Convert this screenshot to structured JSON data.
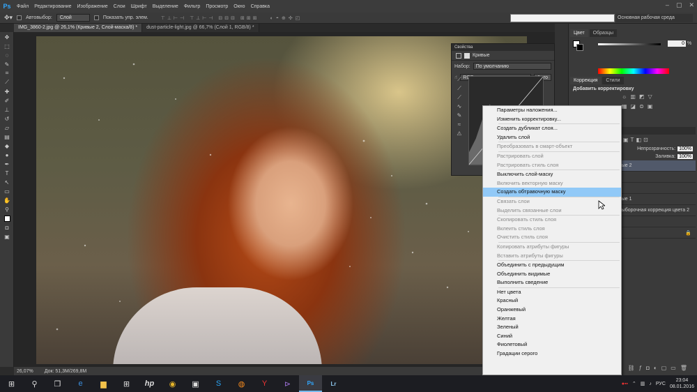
{
  "menu": {
    "logo": "Ps",
    "items": [
      "Файл",
      "Редактирование",
      "Изображение",
      "Слои",
      "Шрифт",
      "Выделение",
      "Фильтр",
      "Просмотр",
      "Окно",
      "Справка"
    ]
  },
  "options": {
    "autoselect": "Автовыбор:",
    "layer_select": "Слой",
    "show_controls": "Показать упр. элем.",
    "workspace": "Основная рабочая среда"
  },
  "tabs": [
    "IMG_3860-2.jpg @ 26,1% (Кривые 2, Слой-маска/8) *",
    "dust-particle-light.jpg @ 66,7% (Слой 1, RGB/8) *"
  ],
  "status": {
    "zoom": "26,07%",
    "doc": "Док: 51,3M/269,8M"
  },
  "properties": {
    "tab": "Свойства",
    "title": "Кривые",
    "preset_label": "Набор:",
    "preset_value": "По умолчанию",
    "channel": "RGB",
    "auto": "Авто"
  },
  "right_panel": {
    "color_tabs": [
      "Цвет",
      "Образцы"
    ],
    "color_value": "0",
    "color_unit": "%",
    "adj_tabs": [
      "Коррекция",
      "Стили"
    ],
    "adj_title": "Добавить корректировку",
    "opacity_label": "Непрозрачность:",
    "opacity_value": "100%",
    "fill_label": "Заливка:",
    "fill_value": "100%",
    "layers": [
      "вые 2",
      "вые 1",
      "выборочная коррекция цвета 2"
    ]
  },
  "context_menu": [
    {
      "label": "Параметры наложения...",
      "disabled": false
    },
    {
      "label": "Изменить корректировку...",
      "disabled": false
    },
    {
      "sep": true
    },
    {
      "label": "Создать дубликат слоя...",
      "disabled": false
    },
    {
      "label": "Удалить слой",
      "disabled": false
    },
    {
      "sep": true
    },
    {
      "label": "Преобразовать в смарт-объект",
      "disabled": true
    },
    {
      "sep": true
    },
    {
      "label": "Растрировать слой",
      "disabled": true
    },
    {
      "label": "Растрировать стиль слоя",
      "disabled": true
    },
    {
      "sep": true
    },
    {
      "label": "Выключить слой-маску",
      "disabled": false
    },
    {
      "label": "Включить векторную маску",
      "disabled": true
    },
    {
      "label": "Создать обтравочную маску",
      "disabled": false,
      "highlight": true
    },
    {
      "sep": true
    },
    {
      "label": "Связать слои",
      "disabled": true
    },
    {
      "label": "Выделить связанные слои",
      "disabled": true
    },
    {
      "sep": true
    },
    {
      "label": "Скопировать стиль слоя",
      "disabled": true
    },
    {
      "label": "Вклеить стиль слоя",
      "disabled": true
    },
    {
      "label": "Очистить стиль слоя",
      "disabled": true
    },
    {
      "sep": true
    },
    {
      "label": "Копировать атрибуты фигуры",
      "disabled": true
    },
    {
      "label": "Вставить атрибуты фигуры",
      "disabled": true
    },
    {
      "sep": true
    },
    {
      "label": "Объединить с предыдущим",
      "disabled": false
    },
    {
      "label": "Объединить видимые",
      "disabled": false
    },
    {
      "label": "Выполнить сведение",
      "disabled": false
    },
    {
      "sep": true
    },
    {
      "label": "Нет цвета",
      "disabled": false
    },
    {
      "label": "Красный",
      "disabled": false
    },
    {
      "label": "Оранжевый",
      "disabled": false
    },
    {
      "label": "Желтая",
      "disabled": false
    },
    {
      "label": "Зеленый",
      "disabled": false
    },
    {
      "label": "Синий",
      "disabled": false
    },
    {
      "label": "Фиолетовый",
      "disabled": false
    },
    {
      "label": "Градации серого",
      "disabled": false
    }
  ],
  "taskbar": {
    "icons": [
      "windows-icon",
      "search-icon",
      "task-view-icon",
      "edge-icon",
      "explorer-icon",
      "store-icon",
      "hp-icon",
      "chrome-icon",
      "media-icon",
      "skype-icon",
      "firefox-icon",
      "yandex-icon",
      "visual-studio-icon",
      "photoshop-icon",
      "lightroom-icon"
    ],
    "time": "23:04",
    "date": "08.01.2016",
    "lang": "РУС"
  },
  "colors": {
    "accent": "#31a8ff",
    "highlight": "#91c9f7"
  }
}
